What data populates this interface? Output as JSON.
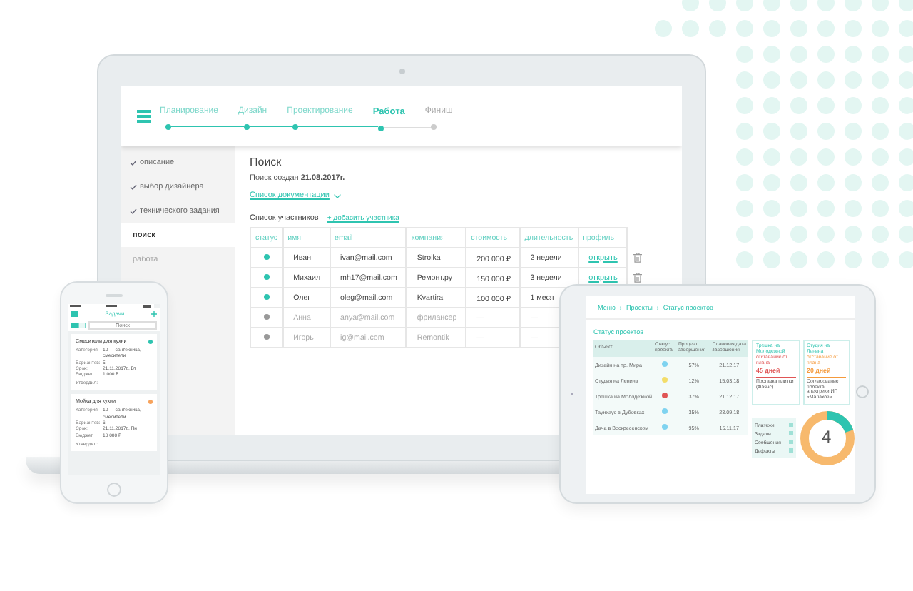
{
  "laptop": {
    "steps": [
      {
        "label": "Планирование",
        "done": true,
        "selected": false
      },
      {
        "label": "Дизайн",
        "done": true,
        "selected": false
      },
      {
        "label": "Проектирование",
        "done": true,
        "selected": false
      },
      {
        "label": "Работа",
        "done": true,
        "selected": true
      },
      {
        "label": "Финиш",
        "done": false,
        "selected": false
      }
    ],
    "sidebar": [
      {
        "label": "описание",
        "checked": true,
        "selected": false,
        "disabled": false
      },
      {
        "label": "выбор дизайнера",
        "checked": true,
        "selected": false,
        "disabled": false
      },
      {
        "label": "технического задания",
        "checked": true,
        "selected": false,
        "disabled": false
      },
      {
        "label": "поиск",
        "checked": false,
        "selected": true,
        "disabled": false
      },
      {
        "label": "работа",
        "checked": false,
        "selected": false,
        "disabled": true
      }
    ],
    "heading": "Поиск",
    "created": "Поиск создан **21.08.2017г.**",
    "docs_link": "Список документации",
    "participants_label": "Список участников",
    "add_link": "+ добавить участника",
    "table": {
      "columns": [
        "статус",
        "имя",
        "email",
        "компания",
        "стоимость",
        "длительность",
        "профиль"
      ],
      "rows": [
        {
          "active": true,
          "cells": [
            "",
            "Иван",
            "ivan@mail.com",
            "Stroika",
            "200 000 ₽",
            "2 недели",
            "открыть"
          ],
          "deletable": true
        },
        {
          "active": true,
          "cells": [
            "",
            "Михаил",
            "mh17@mail.com",
            "Ремонт.ру",
            "150 000 ₽",
            "3 недели",
            "открыть"
          ],
          "deletable": true
        },
        {
          "active": true,
          "cells": [
            "",
            "Олег",
            "oleg@mail.com",
            "Kvartira",
            "100 000 ₽",
            "1 меся"
          ]
        },
        {
          "active": false,
          "cells": [
            "",
            "Анна",
            "anya@mail.com",
            "фрилансер",
            "—",
            "—"
          ]
        },
        {
          "active": false,
          "cells": [
            "",
            "Игорь",
            "ig@mail.com",
            "Remontik",
            "—",
            "—"
          ]
        }
      ]
    }
  },
  "phone": {
    "title": "Задачи",
    "search": {
      "placeholder": "Поиск"
    },
    "cards": [
      {
        "title": "Смесители для кухни",
        "color": "#2ec4b0",
        "fields": [
          {
            "label": "Категория:",
            "value": "10 — сантехника, смесители"
          },
          {
            "label": "Вариантов:",
            "value": "5"
          },
          {
            "label": "Срок:",
            "value": "21.11.2017г., Вт"
          },
          {
            "label": "Бюджет:",
            "value": "1 000 ₽"
          }
        ],
        "approved_label": "Утвердил:"
      },
      {
        "title": "Мойка для кухни",
        "color": "#f7a35c",
        "fields": [
          {
            "label": "Категория:",
            "value": "10 — сантехника, смесители"
          },
          {
            "label": "Вариантов:",
            "value": "6"
          },
          {
            "label": "Срок:",
            "value": "21.11.2017г., Пн"
          },
          {
            "label": "Бюджет:",
            "value": "10 000 ₽"
          }
        ],
        "approved_label": "Утвердил:"
      }
    ]
  },
  "tablet": {
    "breadcrumb": [
      "Меню",
      "Проекты",
      "Статус проектов"
    ],
    "breadcrumb_separator": "›",
    "title": "Статус проектов",
    "table": {
      "columns": [
        "Объект",
        "Статус проекта",
        "Процент завершения",
        "Плановая дата завершения"
      ],
      "rows": [
        {
          "object": "Дизайн на пр. Мира",
          "color": "#7fd3f0",
          "percent": "57%",
          "date": "21.12.17"
        },
        {
          "object": "Студия на Ленина",
          "color": "#f3dd6a",
          "percent": "12%",
          "date": "15.03.18"
        },
        {
          "object": "Трешка на Молодежной",
          "color": "#e05555",
          "percent": "37%",
          "date": "21.12.17"
        },
        {
          "object": "Таунхаус в Дубовках",
          "color": "#7fd3f0",
          "percent": "35%",
          "date": "23.09.18"
        },
        {
          "object": "Дача в Воскресенском",
          "color": "#7fd3f0",
          "percent": "95%",
          "date": "15.11.17"
        }
      ]
    },
    "alerts": [
      {
        "title": "Трешка на Молодежной",
        "note": "отставание от плана",
        "days": "45 дней",
        "color": "#e05555",
        "text": "Поставка плитки (Фаянс)"
      },
      {
        "title": "Студия на Ленина",
        "note": "отставание от плана",
        "days": "20 дней",
        "color": "#f59a3c",
        "text": "Согласование проекта электрики ИП «Малахов»"
      }
    ],
    "legend": [
      {
        "label": "Платежи",
        "checked": true
      },
      {
        "label": "Задачи",
        "checked": true
      },
      {
        "label": "Сообщения",
        "checked": true
      },
      {
        "label": "Дефекты",
        "checked": true
      }
    ],
    "donut_value": "4"
  }
}
